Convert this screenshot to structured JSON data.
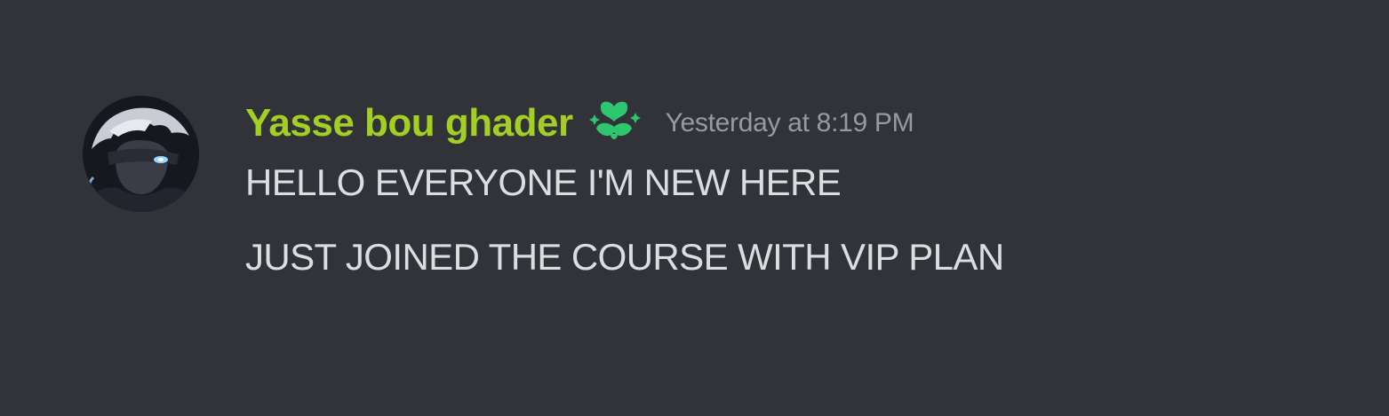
{
  "message": {
    "author": "Yasse bou ghader",
    "role_icon": "green-sparkle-heart-icon",
    "timestamp": "Yesterday at 8:19 PM",
    "lines": [
      "HELLO EVERYONE I'M NEW HERE",
      "JUST JOINED THE COURSE WITH VIP PLAN"
    ]
  },
  "colors": {
    "background": "#313338",
    "username": "#a3cf24",
    "timestamp": "#949ba4",
    "text": "#dbdee1",
    "role_icon": "#2dc770"
  }
}
